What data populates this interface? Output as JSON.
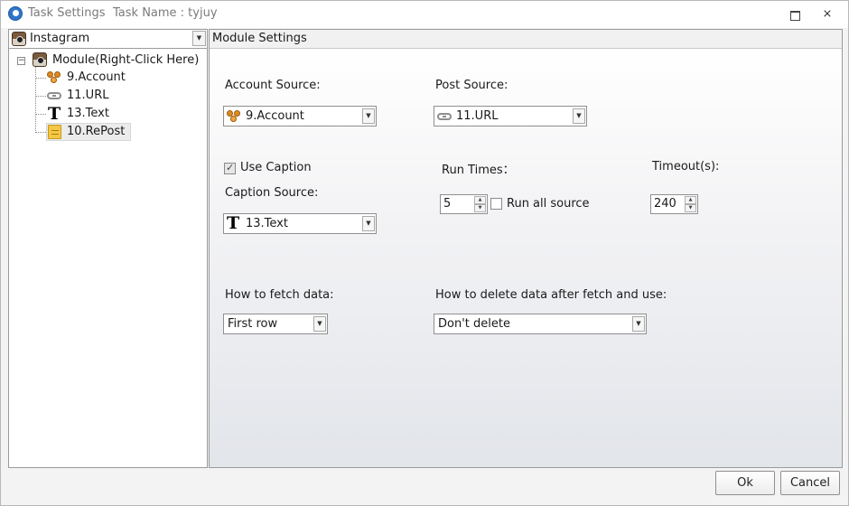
{
  "window": {
    "title": "Task Settings",
    "task_name": "Task Name : tyjuy",
    "restore_icon": "restore-icon",
    "close_icon": "close-icon",
    "close_glyph": "⨯"
  },
  "left_panel": {
    "platform_select": "Instagram",
    "tree": {
      "expander_glyph": "−",
      "root": "Module(Right-Click Here)",
      "items": [
        {
          "label": "9.Account",
          "icon": "account-icon"
        },
        {
          "label": "11.URL",
          "icon": "url-icon"
        },
        {
          "label": "13.Text",
          "icon": "text-icon"
        },
        {
          "label": "10.RePost",
          "icon": "repost-icon",
          "selected": true
        }
      ]
    }
  },
  "module": {
    "header": "Module Settings",
    "account_source": {
      "label": "Account Source:",
      "value": "9.Account"
    },
    "post_source": {
      "label": "Post Source:",
      "value": "11.URL"
    },
    "use_caption": {
      "label": "Use Caption",
      "checked": true
    },
    "caption_source": {
      "label": "Caption Source:",
      "value": "13.Text"
    },
    "run_times": {
      "label": "Run Times：",
      "value": "5"
    },
    "run_all_source": {
      "label": "Run all source",
      "checked": false
    },
    "timeout": {
      "label": "Timeout(s):",
      "value": "240"
    },
    "fetch": {
      "label": "How to fetch data:",
      "value": "First row"
    },
    "delete": {
      "label": "How to delete data after fetch and use:",
      "value": "Don't delete"
    }
  },
  "buttons": {
    "ok": "Ok",
    "cancel": "Cancel"
  },
  "glyphs": {
    "dropdown_arrow": "▼",
    "spin_up": "▲",
    "spin_down": "▼"
  }
}
